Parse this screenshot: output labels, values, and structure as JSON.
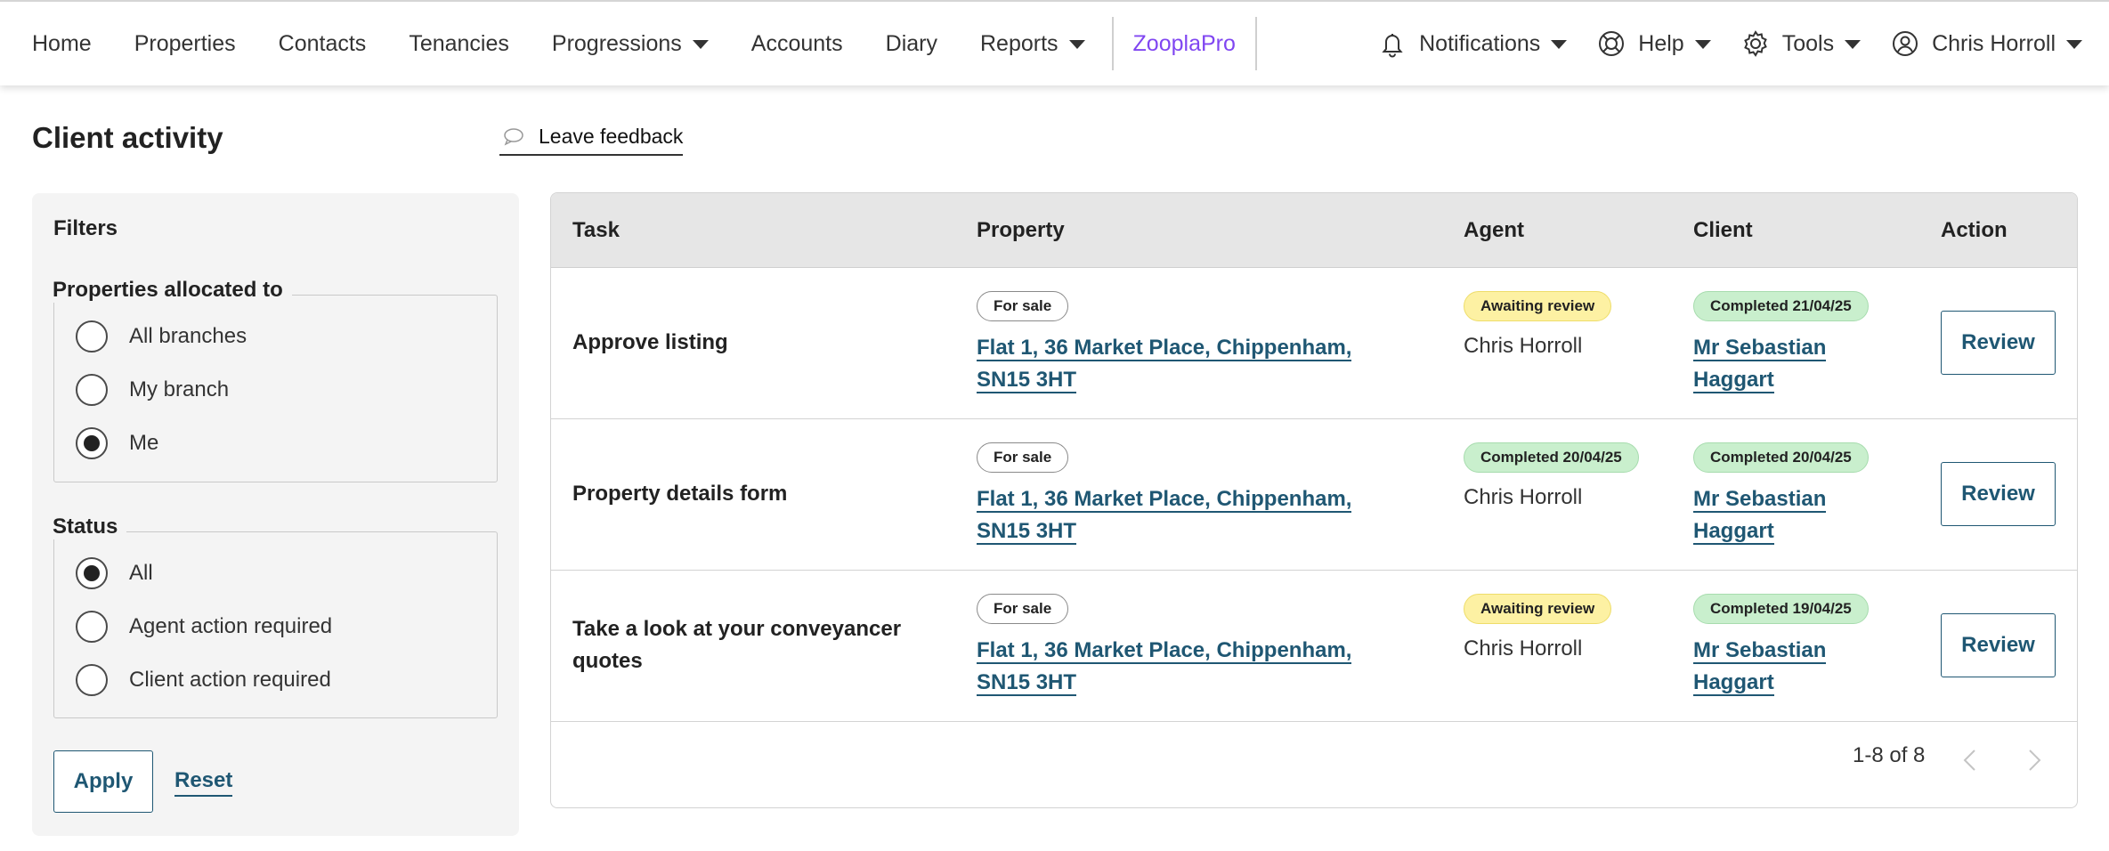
{
  "nav": {
    "left": [
      {
        "label": "Home",
        "dropdown": false
      },
      {
        "label": "Properties",
        "dropdown": false
      },
      {
        "label": "Contacts",
        "dropdown": false
      },
      {
        "label": "Tenancies",
        "dropdown": false
      },
      {
        "label": "Progressions",
        "dropdown": true
      },
      {
        "label": "Accounts",
        "dropdown": false
      },
      {
        "label": "Diary",
        "dropdown": false
      },
      {
        "label": "Reports",
        "dropdown": true
      }
    ],
    "zoopla": "ZooplaPro",
    "right": {
      "notifications": "Notifications",
      "help": "Help",
      "tools": "Tools",
      "user": "Chris Horroll"
    },
    "icons": {
      "notifications": "bell-icon",
      "help": "lifebuoy-icon",
      "tools": "gear-icon",
      "user": "user-circle-icon"
    },
    "accent_color": "#8046f1"
  },
  "page": {
    "title": "Client activity",
    "feedback": "Leave feedback"
  },
  "filters": {
    "title": "Filters",
    "allocated": {
      "legend": "Properties allocated to",
      "options": [
        {
          "label": "All branches",
          "checked": false
        },
        {
          "label": "My branch",
          "checked": false
        },
        {
          "label": "Me",
          "checked": true
        }
      ]
    },
    "status": {
      "legend": "Status",
      "options": [
        {
          "label": "All",
          "checked": true
        },
        {
          "label": "Agent action required",
          "checked": false
        },
        {
          "label": "Client action required",
          "checked": false
        }
      ]
    },
    "apply": "Apply",
    "reset": "Reset"
  },
  "table": {
    "headers": {
      "task": "Task",
      "property": "Property",
      "agent": "Agent",
      "client": "Client",
      "action": "Action"
    },
    "rows": [
      {
        "task": "Approve listing",
        "property_status": "For sale",
        "property": "Flat 1, 36 Market Place, Chippenham, SN15 3HT",
        "agent_status": "Awaiting review",
        "agent_status_type": "awaiting",
        "agent": "Chris Horroll",
        "client_status": "Completed 21/04/25",
        "client": "Mr Sebastian Haggart",
        "action": "Review"
      },
      {
        "task": "Property details form",
        "property_status": "For sale",
        "property": "Flat 1, 36 Market Place, Chippenham, SN15 3HT",
        "agent_status": "Completed 20/04/25",
        "agent_status_type": "completed",
        "agent": "Chris Horroll",
        "client_status": "Completed 20/04/25",
        "client": "Mr Sebastian Haggart",
        "action": "Review"
      },
      {
        "task": "Take a look at your conveyancer quotes",
        "property_status": "For sale",
        "property": "Flat 1, 36 Market Place, Chippenham, SN15 3HT",
        "agent_status": "Awaiting review",
        "agent_status_type": "awaiting",
        "agent": "Chris Horroll",
        "client_status": "Completed 19/04/25",
        "client": "Mr Sebastian Haggart",
        "action": "Review"
      }
    ],
    "pagination": "1-8 of 8"
  }
}
